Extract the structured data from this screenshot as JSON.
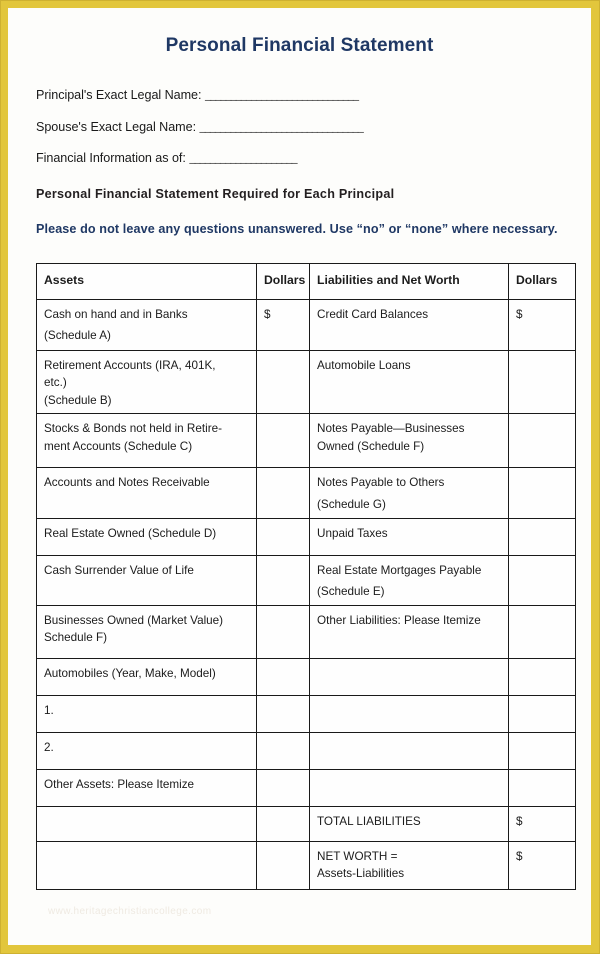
{
  "document": {
    "title": "Personal Financial Statement",
    "title_color": "#1f3864",
    "border_color": "#e2c63c",
    "page_color": "#fdfdfb",
    "watermark": "www.heritagechristiancollege.com"
  },
  "form_fields": [
    {
      "label": "Principal's Exact Legal Name:",
      "value": "",
      "rule": "______________________________"
    },
    {
      "label": "Spouse's Exact Legal Name:",
      "value": "",
      "rule": "________________________________"
    },
    {
      "label": "Financial Information as of:",
      "value": "",
      "rule": "_____________________"
    }
  ],
  "notices": {
    "required": "Personal Financial Statement Required for Each Principal",
    "answer_all": "Please do not leave any questions unanswered.  Use “no” or “none” where necessary."
  },
  "table": {
    "headers": {
      "assets": "Assets",
      "dollars_assets": "Dollars",
      "liabilities": "Liabilities and Net Worth",
      "dollars_liabilities": "Dollars"
    },
    "rows": [
      {
        "asset_lines": [
          "Cash on hand and in Banks",
          "(Schedule A)"
        ],
        "asset_dollar": "$",
        "liability_lines": [
          "Credit Card Balances"
        ],
        "liability_dollar": "$"
      },
      {
        "asset_lines": [
          "Retirement Accounts (IRA, 401K,",
          "etc.)",
          "(Schedule B)"
        ],
        "asset_dollar": "",
        "liability_lines": [
          "Automobile Loans"
        ],
        "liability_dollar": ""
      },
      {
        "asset_lines": [
          "Stocks & Bonds not held in Retire-",
          "ment Accounts (Schedule C)"
        ],
        "asset_dollar": "",
        "liability_lines": [
          "Notes Payable—Businesses",
          "Owned (Schedule F)"
        ],
        "liability_dollar": ""
      },
      {
        "asset_lines": [
          "Accounts and Notes Receivable"
        ],
        "asset_dollar": "",
        "liability_lines": [
          "Notes Payable to Others",
          "(Schedule G)"
        ],
        "liability_dollar": ""
      },
      {
        "asset_lines": [
          "Real Estate Owned (Schedule D)"
        ],
        "asset_dollar": "",
        "liability_lines": [
          "Unpaid Taxes"
        ],
        "liability_dollar": ""
      },
      {
        "asset_lines": [
          "Cash Surrender Value of Life"
        ],
        "asset_dollar": "",
        "liability_lines": [
          " Real Estate Mortgages Payable",
          "(Schedule E)"
        ],
        "liability_dollar": ""
      },
      {
        "asset_lines": [
          "Businesses Owned (Market Value)",
          "Schedule F)"
        ],
        "asset_dollar": "",
        "liability_lines": [
          "Other Liabilities: Please Itemize"
        ],
        "liability_dollar": ""
      },
      {
        "asset_lines": [
          "Automobiles (Year, Make, Model)"
        ],
        "asset_dollar": "",
        "liability_lines": [],
        "liability_dollar": ""
      },
      {
        "asset_lines": [
          "1."
        ],
        "asset_dollar": "",
        "liability_lines": [],
        "liability_dollar": ""
      },
      {
        "asset_lines": [
          "2."
        ],
        "asset_dollar": "",
        "liability_lines": [],
        "liability_dollar": ""
      },
      {
        "asset_lines": [
          "Other Assets: Please Itemize"
        ],
        "asset_dollar": "",
        "liability_lines": [],
        "liability_dollar": ""
      },
      {
        "asset_lines": [],
        "asset_dollar": "",
        "liability_lines": [
          "TOTAL  LIABILITIES"
        ],
        "liability_dollar": "$"
      },
      {
        "asset_lines": [],
        "asset_dollar": "",
        "liability_lines": [
          "NET WORTH  =",
          "Assets-Liabilities"
        ],
        "liability_dollar": "$"
      }
    ]
  }
}
